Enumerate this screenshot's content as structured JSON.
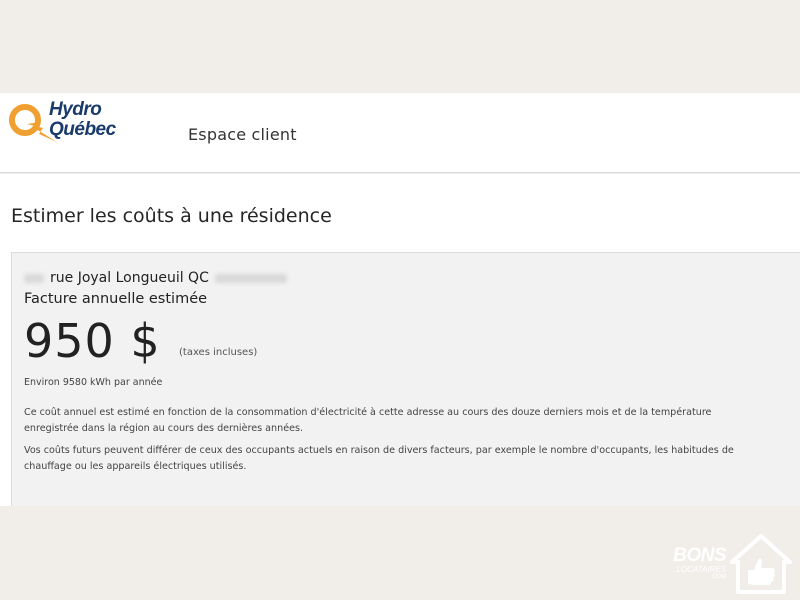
{
  "header": {
    "brand_line1": "Hydro",
    "brand_line2": "Québec",
    "nav_label": "Espace client"
  },
  "page": {
    "title": "Estimer les coûts à une résidence"
  },
  "card": {
    "address": "rue Joyal Longueuil QC",
    "bill_label": "Facture annuelle estimée",
    "amount": "950 $",
    "taxes_note": "(taxes incluses)",
    "consumption": "Environ 9580 kWh par année",
    "paragraph1": "Ce coût annuel est estimé en fonction de la consommation d'électricité à cette adresse au cours des douze derniers mois et de la température enregistrée dans la région au cours des dernières années.",
    "paragraph2": "Vos coûts futurs peuvent différer de ceux des occupants actuels en raison de divers facteurs, par exemple le nombre d'occupants, les habitudes de chauffage ou les appareils électriques utilisés."
  },
  "watermark": {
    "line1": "BONS",
    "line2": "LOCATAIRES",
    "line3": ".COM"
  },
  "colors": {
    "brand_orange": "#f0a030",
    "brand_navy": "#1a3a6b",
    "card_bg": "#f2f2f3",
    "page_bg": "#f1eeea"
  }
}
